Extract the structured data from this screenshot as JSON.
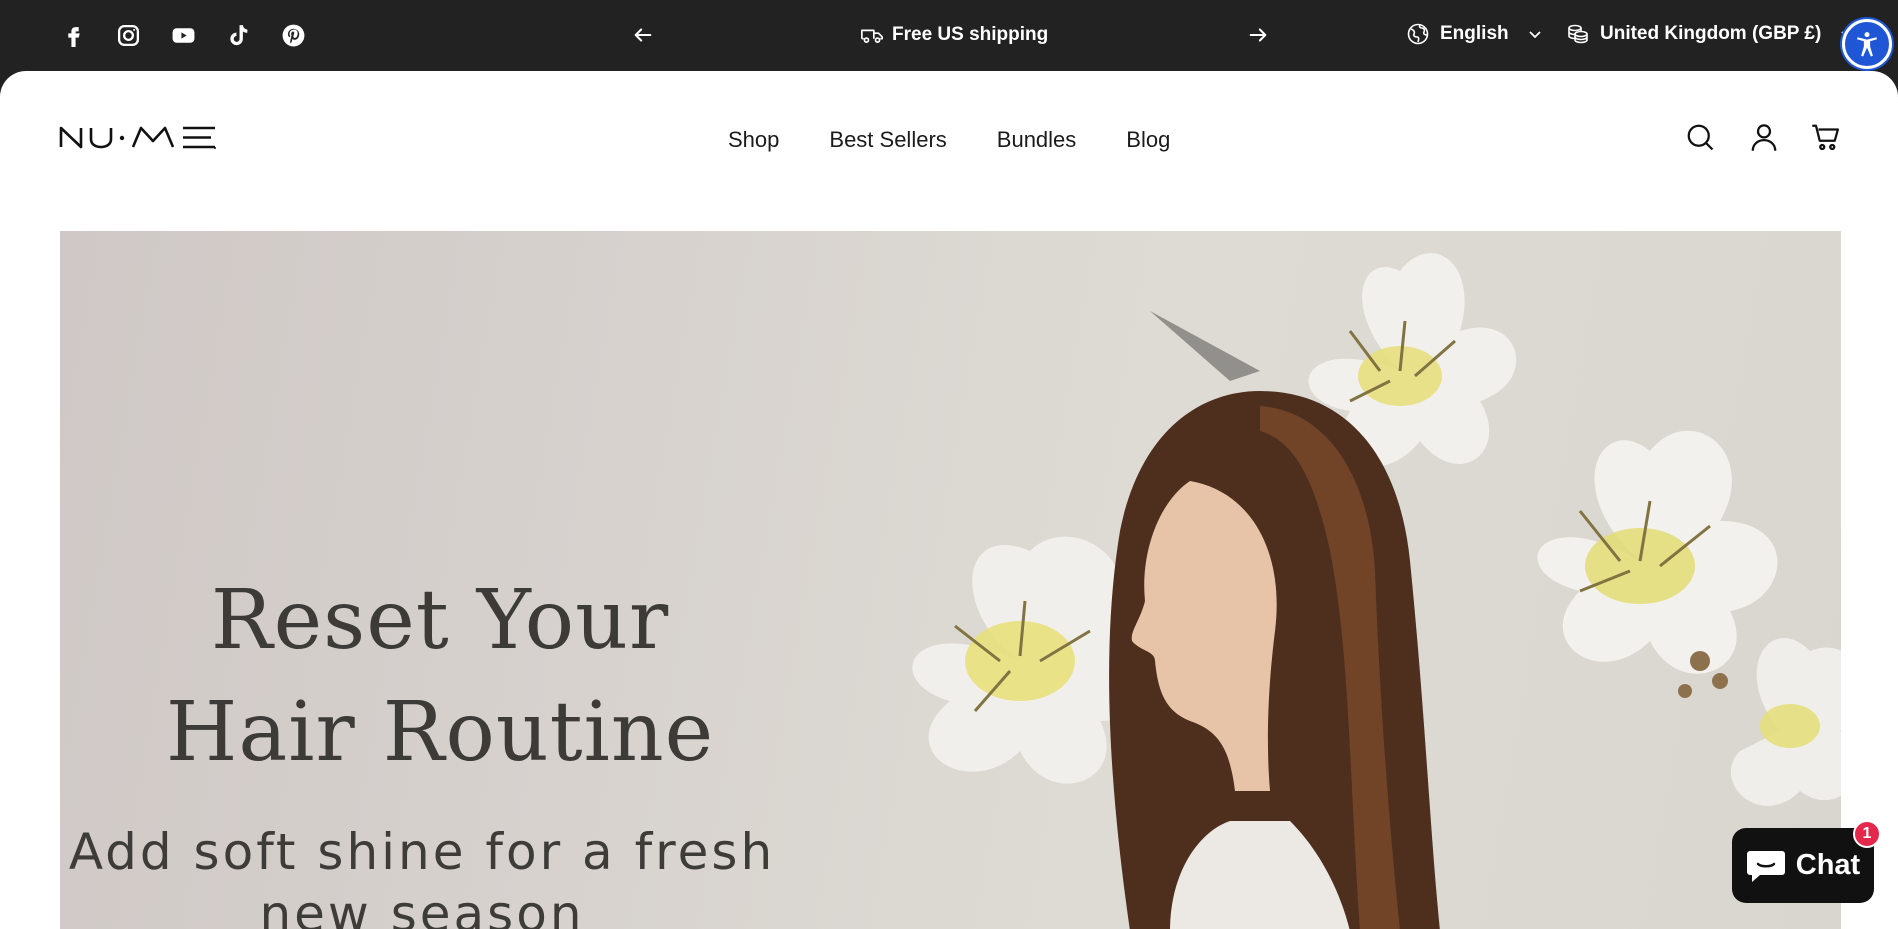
{
  "topbar": {
    "social": [
      "facebook-icon",
      "instagram-icon",
      "youtube-icon",
      "tiktok-icon",
      "pinterest-icon"
    ],
    "announcement": "Free US shipping",
    "language": "English",
    "currency": "United Kingdom (GBP £)"
  },
  "header": {
    "logo_text": "NU·ME",
    "nav": [
      "Shop",
      "Best Sellers",
      "Bundles",
      "Blog"
    ],
    "icons": [
      "search-icon",
      "account-icon",
      "cart-icon"
    ]
  },
  "hero": {
    "title_line1": "Reset Your",
    "title_line2": "Hair Routine",
    "subtitle_line1": "Add soft shine for a fresh",
    "subtitle_line2": "new season"
  },
  "chat": {
    "label": "Chat",
    "badge": "1"
  },
  "colors": {
    "topbar": "#222222",
    "accessibility": "#1e56d6",
    "chat_badge": "#e3284b"
  }
}
